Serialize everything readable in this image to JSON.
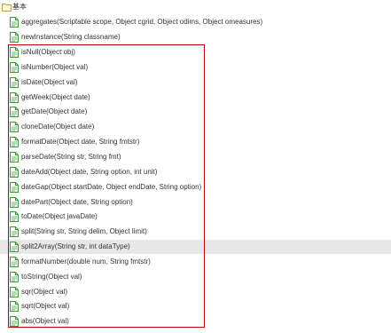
{
  "tree": {
    "folder": {
      "label": "基本",
      "icon": "folder-icon"
    },
    "items": [
      {
        "label": "aggregates(Scriptable scope, Object cgrid, Object odims, Object omeasures)",
        "icon": "file-icon"
      },
      {
        "label": "newInstance(String classname)",
        "icon": "file-icon"
      },
      {
        "label": "isNull(Object obj)",
        "icon": "file-icon"
      },
      {
        "label": "isNumber(Object val)",
        "icon": "file-icon"
      },
      {
        "label": "isDate(Object val)",
        "icon": "file-icon"
      },
      {
        "label": "getWeek(Object date)",
        "icon": "file-icon"
      },
      {
        "label": "getDate(Object date)",
        "icon": "file-icon"
      },
      {
        "label": "cloneDate(Object date)",
        "icon": "file-icon"
      },
      {
        "label": "formatDate(Object date, String fmtstr)",
        "icon": "file-icon"
      },
      {
        "label": "parseDate(String str, String fmt)",
        "icon": "file-icon"
      },
      {
        "label": "dateAdd(Object date, String option, int unit)",
        "icon": "file-icon"
      },
      {
        "label": "dateGap(Object startDate, Object endDate, String option)",
        "icon": "file-icon"
      },
      {
        "label": "datePart(Object date, String option)",
        "icon": "file-icon"
      },
      {
        "label": "toDate(Object javaDate)",
        "icon": "file-icon"
      },
      {
        "label": "split(String str, String delim, Object limit)",
        "icon": "file-icon"
      },
      {
        "label": "split2Array(String str, int dataType)",
        "icon": "file-icon",
        "selected": true
      },
      {
        "label": "formatNumber(double num, String fmtstr)",
        "icon": "file-icon"
      },
      {
        "label": "toString(Object val)",
        "icon": "file-icon"
      },
      {
        "label": "sqr(Object val)",
        "icon": "file-icon"
      },
      {
        "label": "sqrt(Object val)",
        "icon": "file-icon"
      },
      {
        "label": "abs(Object val)",
        "icon": "file-icon"
      }
    ]
  },
  "colors": {
    "icon_green": "#3a9a3a",
    "highlight_border": "#c00000",
    "selected_bg": "#e8e8e8",
    "folder_stroke": "#c8a040"
  }
}
